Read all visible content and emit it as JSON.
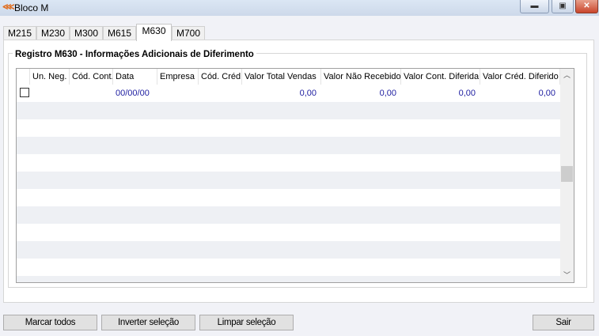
{
  "window": {
    "title": "Bloco M",
    "icon": "app-logo-icon",
    "controls": [
      "minimize",
      "maximize",
      "close"
    ]
  },
  "tabs": [
    {
      "label": "M215"
    },
    {
      "label": "M230"
    },
    {
      "label": "M300"
    },
    {
      "label": "M615"
    },
    {
      "label": "M630",
      "active": true
    },
    {
      "label": "M700"
    }
  ],
  "group": {
    "title": "Registro M630 - Informações Adicionais de Diferimento"
  },
  "grid": {
    "columns": [
      "",
      "Un. Neg.",
      "Cód. Cont.",
      "Data",
      "Empresa",
      "Cód. Créd.",
      "Valor Total Vendas",
      "Valor Não Recebido",
      "Valor Cont. Diferida",
      "Valor Créd. Diferido"
    ],
    "rows": [
      {
        "checked": false,
        "un_neg": "",
        "cod_cont": "",
        "data": "00/00/00",
        "empresa": "",
        "cod_cred": "",
        "valor_total_vendas": "0,00",
        "valor_nao_recebido": "0,00",
        "valor_cont_diferida": "0,00",
        "valor_cred_diferido": "0,00"
      }
    ]
  },
  "buttons": {
    "marcar_todos": "Marcar todos",
    "inverter": "Inverter seleção",
    "limpar": "Limpar seleção",
    "sair": "Sair"
  },
  "colors": {
    "value_text": "#1c1ca0"
  }
}
